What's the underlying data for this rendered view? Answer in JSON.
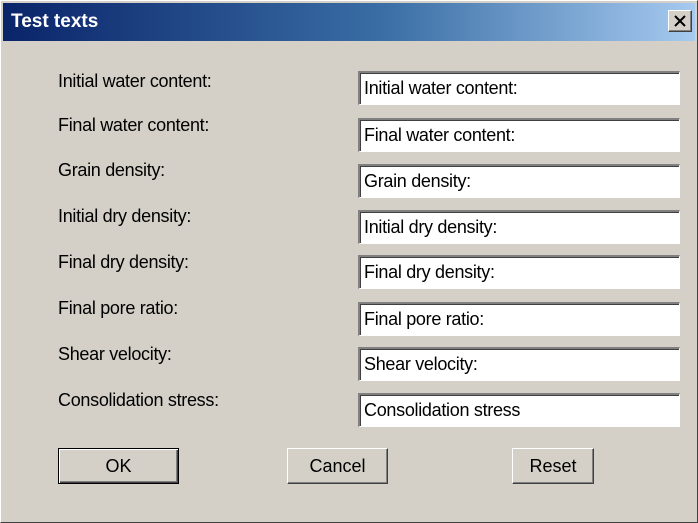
{
  "dialog": {
    "title": "Test texts",
    "close_glyph": "✕"
  },
  "fields": [
    {
      "label": "Initial water content:",
      "value": "Initial water content:"
    },
    {
      "label": "Final water content:",
      "value": "Final water content:"
    },
    {
      "label": "Grain density:",
      "value": "Grain density:"
    },
    {
      "label": "Initial dry density:",
      "value": "Initial dry density:"
    },
    {
      "label": "Final dry density:",
      "value": "Final dry density:"
    },
    {
      "label": "Final pore ratio:",
      "value": "Final pore ratio:"
    },
    {
      "label": "Shear velocity:",
      "value": "Shear velocity:"
    },
    {
      "label": "Consolidation stress:",
      "value": "Consolidation stress"
    }
  ],
  "buttons": {
    "ok": "OK",
    "cancel": "Cancel",
    "reset": "Reset"
  },
  "colors": {
    "title_gradient_start": "#0a246a",
    "title_gradient_end": "#a6caf0",
    "dialog_face": "#d4d0c8"
  }
}
